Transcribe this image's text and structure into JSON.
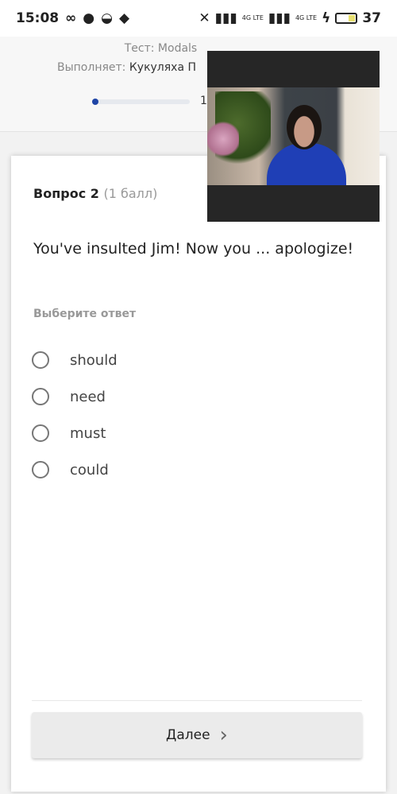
{
  "status_bar": {
    "time": "15:08",
    "net1": "4G LTE",
    "net2": "4G LTE",
    "battery": "37",
    "icons": [
      "infinity-icon",
      "chat-icon",
      "circle-icon",
      "layers-icon",
      "no-signal-icon",
      "signal-icon",
      "signal-icon",
      "charging-icon",
      "battery-icon"
    ]
  },
  "header": {
    "test_label": "Тест: Modals",
    "performer_label": "Выполняет:",
    "performer_name": "Кукуляха П",
    "progress_text": "1",
    "progress_fraction": 0.05,
    "accent": "#1f45a6"
  },
  "question": {
    "title": "Вопрос 2",
    "points": "(1 балл)",
    "text": "You've insulted Jim! Now you ... apologize!",
    "prompt": "Выберите ответ",
    "options": [
      {
        "label": "should"
      },
      {
        "label": "need"
      },
      {
        "label": "must"
      },
      {
        "label": "could"
      }
    ]
  },
  "next_button": {
    "label": "Далее"
  }
}
